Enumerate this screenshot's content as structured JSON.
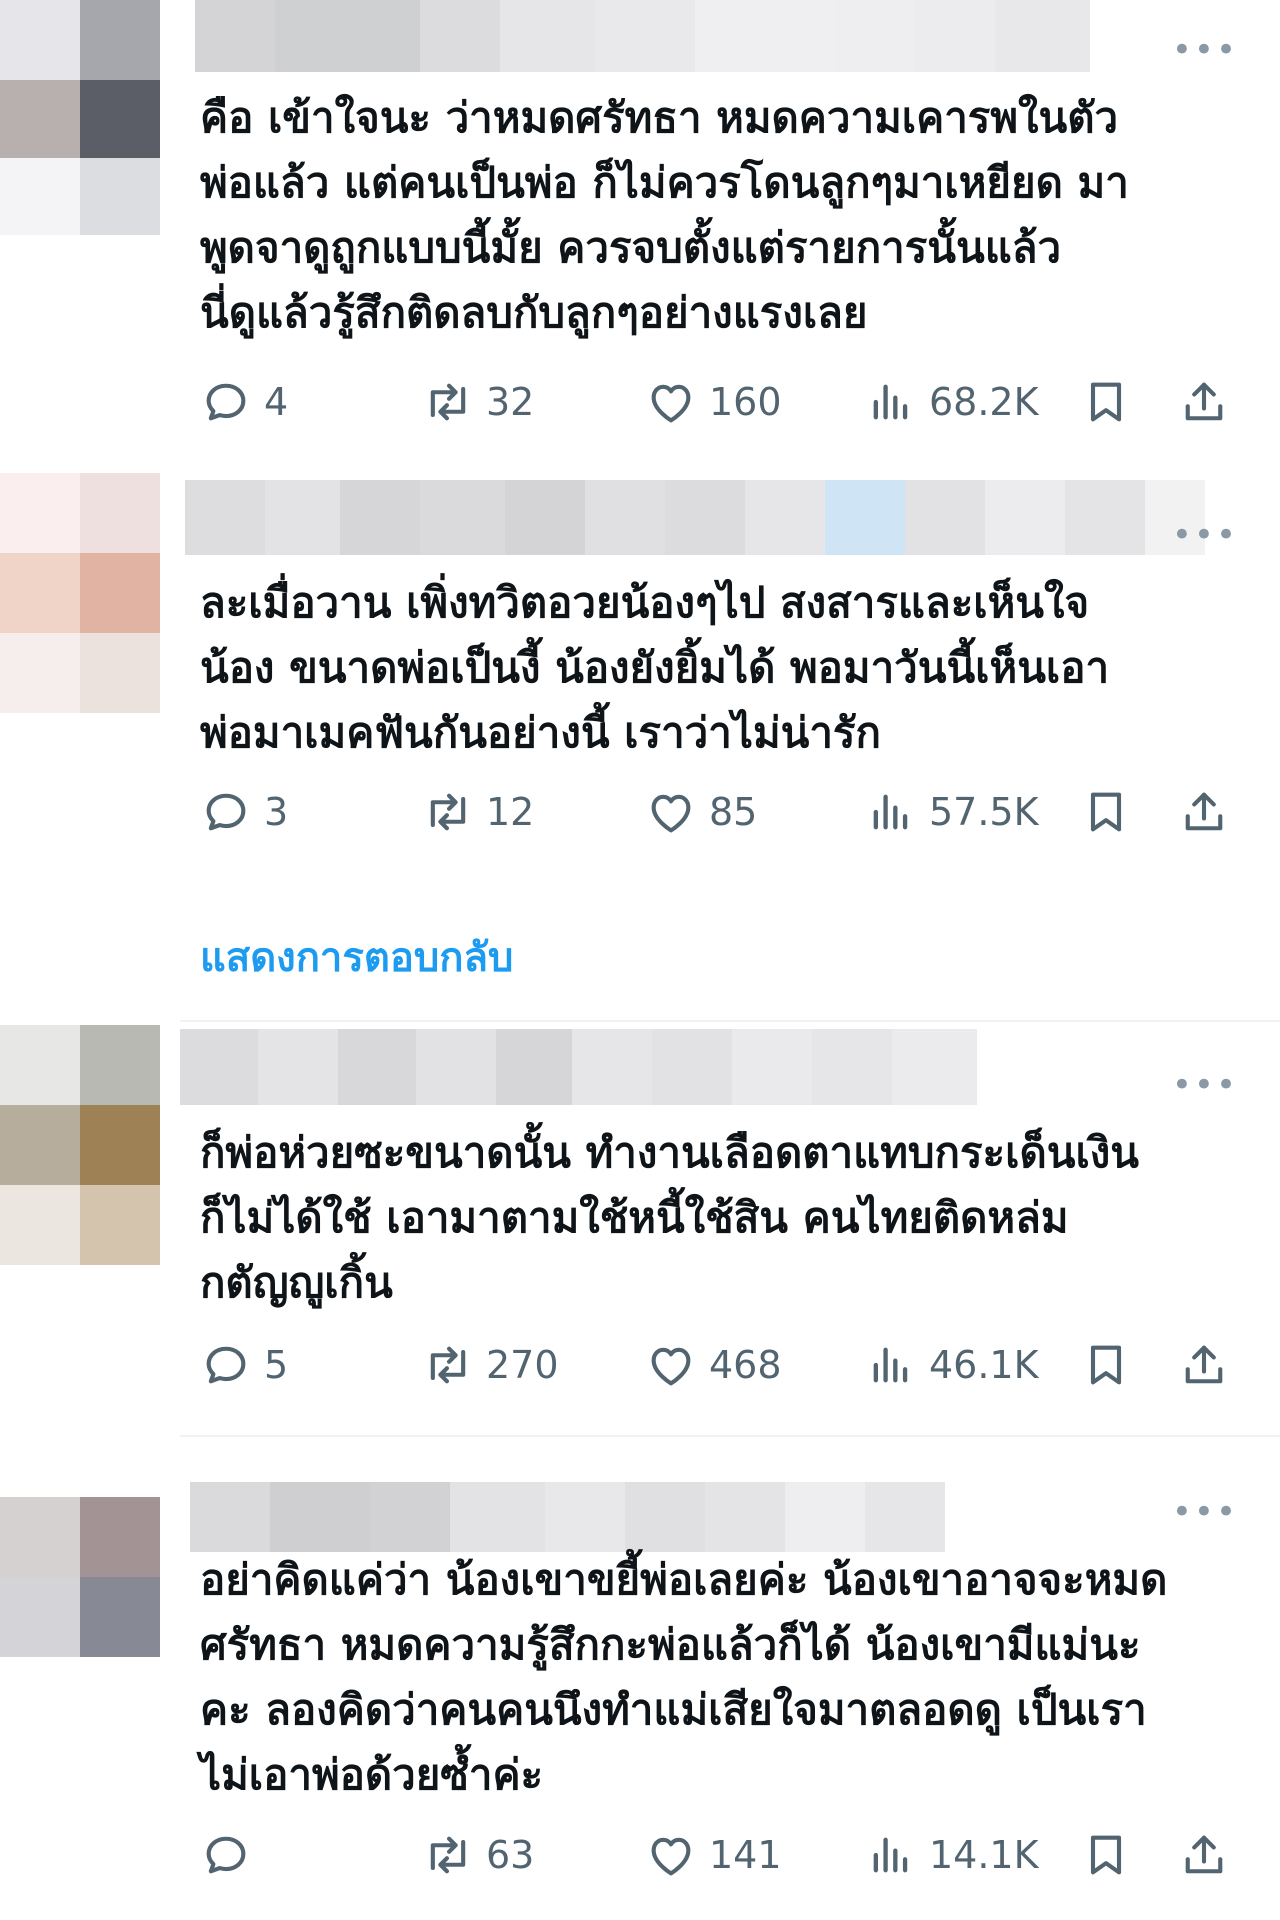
{
  "posts": [
    {
      "text": "คือ เข้าใจนะ ว่าหมดศรัทธา หมดความเคารพในตัว\nพ่อแล้ว แต่คนเป็นพ่อ ก็ไม่ควรโดนลูกๆมาเหยียด มา\nพูดจาดูถูกแบบนี้มั้ย ควรจบตั้งแต่รายการนั้นแล้ว\nนี่ดูแล้วรู้สึกติดลบกับลูกๆอย่างแรงเลย",
      "replies": "4",
      "reposts": "32",
      "likes": "160",
      "views": "68.2K"
    },
    {
      "text": "ละเมื่อวาน เพิ่งทวิตอวยน้องๆไป สงสารและเห็นใจ\nน้อง ขนาดพ่อเป็นงี้ น้องยังยิ้มได้  พอมาวันนี้เห็นเอา\nพ่อมาเมคฟันกันอย่างนี้ เราว่าไม่น่ารัก",
      "replies": "3",
      "reposts": "12",
      "likes": "85",
      "views": "57.5K"
    },
    {
      "text": "ก็พ่อห่วยซะขนาดนั้น ทำงานเลือดตาแทบกระเด็นเงิน\nก็ไม่ได้ใช้ เอามาตามใช้หนี้ใช้สิน คนไทยติดหล่ม\nกตัญญูเกิ้น",
      "replies": "5",
      "reposts": "270",
      "likes": "468",
      "views": "46.1K"
    },
    {
      "text": "อย่าคิดแค่ว่า น้องเขาขยี้พ่อเลยค่ะ น้องเขาอาจจะหมด\nศรัทธา หมดความรู้สึกกะพ่อแล้วก็ได้ น้องเขามีแม่นะ\nคะ ลองคิดว่าคนคนนึงทำแม่เสียใจมาตลอดดู เป็นเรา\nไม่เอาพ่อด้วยซ้ำค่ะ",
      "replies": "",
      "reposts": "63",
      "likes": "141",
      "views": "14.1K"
    }
  ],
  "show_replies_label": "แสดงการตอบกลับ",
  "more_label": "•••",
  "colors": {
    "accent": "#1d9bf0",
    "muted": "#536471",
    "text": "#0f1419"
  },
  "icons": [
    "reply-icon",
    "repost-icon",
    "like-icon",
    "views-icon",
    "bookmark-icon",
    "share-icon",
    "more-icon"
  ]
}
